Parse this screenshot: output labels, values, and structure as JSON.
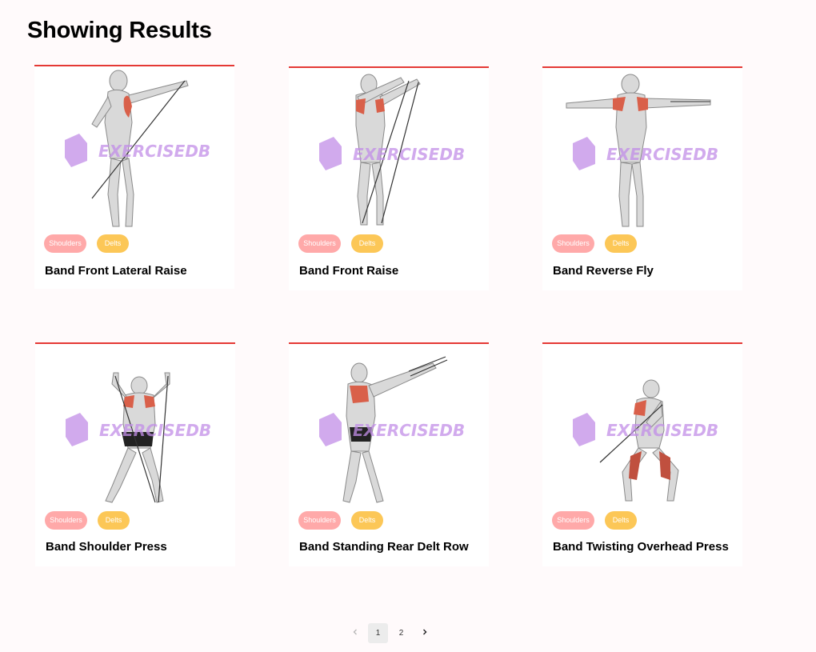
{
  "page": {
    "title": "Showing Results"
  },
  "watermark": "EXERCISEDB",
  "cards": [
    {
      "name": "Band Front Lateral Raise",
      "body_part": "Shoulders",
      "target": "Delts"
    },
    {
      "name": "Band Front Raise",
      "body_part": "Shoulders",
      "target": "Delts"
    },
    {
      "name": "Band Reverse Fly",
      "body_part": "Shoulders",
      "target": "Delts"
    },
    {
      "name": "Band Shoulder Press",
      "body_part": "Shoulders",
      "target": "Delts"
    },
    {
      "name": "Band Standing Rear Delt Row",
      "body_part": "Shoulders",
      "target": "Delts"
    },
    {
      "name": "Band Twisting Overhead Press",
      "body_part": "Shoulders",
      "target": "Delts"
    }
  ],
  "pagination": {
    "prev_icon": "chevron-left-icon",
    "pages": [
      "1",
      "2"
    ],
    "current_page": "1",
    "next_icon": "chevron-right-icon"
  },
  "colors": {
    "card_top_border": "#e53935",
    "body_part_tag": "#ffa9a9",
    "target_tag": "#fcc757",
    "watermark": "#c28ee8",
    "page_background": "#fffafb"
  }
}
